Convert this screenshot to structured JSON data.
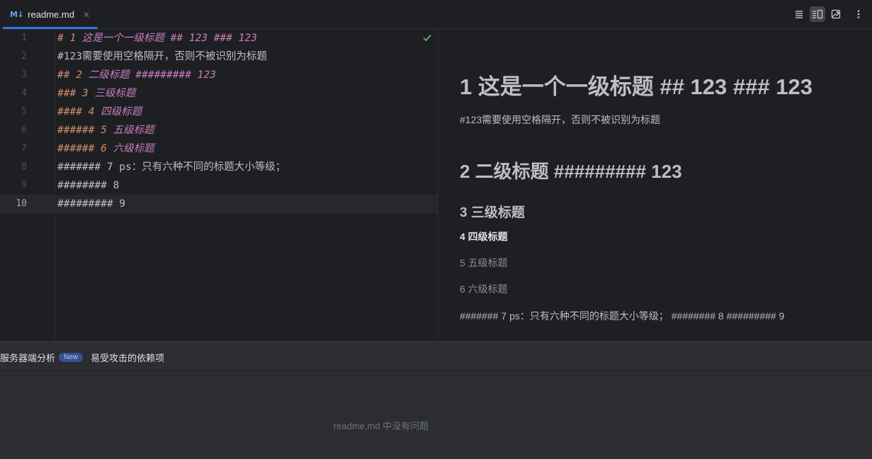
{
  "tab": {
    "icon": "M↓",
    "label": "readme.md",
    "close": "✕"
  },
  "toolbar": {
    "icons": [
      "editor-only-icon",
      "split-view-icon",
      "preview-only-icon",
      "more-options-icon"
    ]
  },
  "editor": {
    "lines": [
      {
        "num": "1",
        "parts": [
          [
            "h-mark",
            "# 1 "
          ],
          [
            "h-text",
            "这是一个一级标题 ## 123 ### 123"
          ]
        ]
      },
      {
        "num": "2",
        "parts": [
          [
            "plain",
            "#123需要使用空格隔开，否则不被识别为标题"
          ]
        ]
      },
      {
        "num": "3",
        "parts": [
          [
            "h-mark",
            "## 2 "
          ],
          [
            "h-text",
            "二级标题 ######### 123"
          ]
        ]
      },
      {
        "num": "4",
        "parts": [
          [
            "h-mark",
            "### 3 "
          ],
          [
            "h-text",
            "三级标题"
          ]
        ]
      },
      {
        "num": "5",
        "parts": [
          [
            "h-mark",
            "#### 4 "
          ],
          [
            "h-text",
            "四级标题"
          ]
        ]
      },
      {
        "num": "6",
        "parts": [
          [
            "h-mark",
            "###### 5 "
          ],
          [
            "h-text",
            "五级标题"
          ]
        ]
      },
      {
        "num": "7",
        "parts": [
          [
            "h-mark",
            "###### 6 "
          ],
          [
            "h-text",
            "六级标题"
          ]
        ]
      },
      {
        "num": "8",
        "parts": [
          [
            "plain",
            "####### 7 ps：只有六种不同的标题大小等级；"
          ]
        ]
      },
      {
        "num": "9",
        "parts": [
          [
            "plain",
            "######## 8"
          ]
        ]
      },
      {
        "num": "10",
        "parts": [
          [
            "plain",
            "######### 9"
          ]
        ]
      }
    ],
    "current_line": 10
  },
  "preview": {
    "h1": "1 这是一个一级标题 ## 123 ### 123",
    "p1": "#123需要使用空格隔开，否则不被识别为标题",
    "h2": "2 二级标题 ######### 123",
    "h3": "3 三级标题",
    "h4": "4 四级标题",
    "h5": "5 五级标题",
    "h6": "6 六级标题",
    "p2": "####### 7 ps：只有六种不同的标题大小等级； ######## 8 ######### 9"
  },
  "panel": {
    "tab1": "服务器端分析",
    "tab1_badge": "New",
    "tab2": "易受攻击的依赖项",
    "empty_message": "readme.md 中没有问题"
  },
  "colors": {
    "accent": "#3574f0",
    "check": "#5fb865",
    "heading_mark": "#cf8e6d",
    "heading_text": "#c77dbb"
  }
}
